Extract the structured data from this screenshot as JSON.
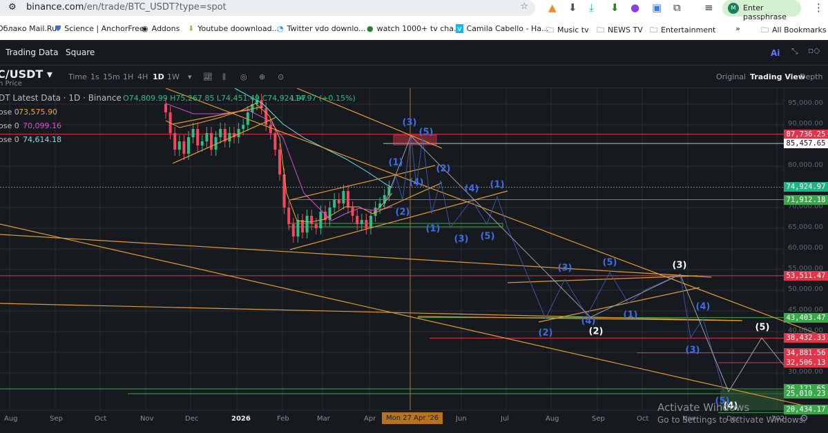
{
  "browser": {
    "url_host": "binance.com",
    "url_path": "/en/trade/BTC_USDT?type=spot",
    "profile_label": "Enter passphrase",
    "profile_initial": "M",
    "bookmarks": [
      "Облако Mail.Ru",
      "Science | AnchorFree",
      "Addons",
      "Youtube doownload...",
      "Twitter vdo downlo...",
      "watch 1000+ tv cha...",
      "Camila Cabello - Ha...",
      "Music tv",
      "NEWS TV",
      "Entertainment",
      "»",
      "All Bookmarks"
    ]
  },
  "nav": {
    "items": [
      "Trading Data",
      "Square"
    ],
    "ai_label": "Ai"
  },
  "toolbar": {
    "symbol": "C/USDT",
    "subtitle": "n Price",
    "intervals": [
      "Time",
      "1s",
      "15m",
      "1H",
      "4H",
      "1D",
      "1W"
    ],
    "active_interval": "1D",
    "views": [
      "Original",
      "Trading View",
      "Depth"
    ],
    "active_view": "Trading View"
  },
  "legend": {
    "title": "DT Latest Data · 1D · Binance",
    "ohlc": "O74,809.99 H75,267.85 L74,451.49 C74,924.97",
    "change": "114.97 (+0.15%)",
    "mas": [
      {
        "label": "ose 0",
        "value": "73,575.90",
        "color": "#f0a53a"
      },
      {
        "label": "ose 0",
        "value": "70,099.16",
        "color": "#d94fd4"
      },
      {
        "label": "ose 0",
        "value": "74,614.18",
        "color": "#6ee0e6"
      }
    ]
  },
  "chart_data": {
    "type": "candlestick",
    "price_ticks": [
      "95,000.00",
      "90,000.00",
      "80,000.00",
      "70,000.00",
      "65,000.00",
      "60,000.00",
      "55,000.00",
      "50,000.00",
      "45,000.00",
      "40,000.00",
      "35,000.00",
      "30,000.00"
    ],
    "time_ticks": [
      "Aug",
      "Sep",
      "Oct",
      "Nov",
      "Dec",
      "2026",
      "Feb",
      "Mar",
      "Apr",
      "Mon 27 Apr '26",
      "Jun",
      "Jul",
      "Aug",
      "Sep",
      "Oct",
      "Nov",
      "Dec",
      "202"
    ],
    "approx_closes": [
      93000,
      88000,
      84000,
      86000,
      83000,
      87000,
      89000,
      85000,
      86000,
      88000,
      84000,
      87000,
      89000,
      86000,
      88000,
      87000,
      89000,
      90000,
      93000,
      95000,
      96000,
      94000,
      90000,
      88000,
      84000,
      78000,
      70000,
      66000,
      63000,
      67000,
      64000,
      68000,
      66000,
      65000,
      69000,
      67000,
      70000,
      72000,
      71000,
      74000,
      70000,
      68000,
      66000,
      67000,
      65000,
      68000,
      70000,
      71000,
      73000,
      75000
    ],
    "price_labels": [
      {
        "value": "87,736.25",
        "color": "#e0354a"
      },
      {
        "value": "85,457.65",
        "color": "#ffffff"
      },
      {
        "value": "74,924.97",
        "color": "#1fb482"
      },
      {
        "value": "71,912.18",
        "color": "#3aa84a"
      },
      {
        "value": "53,511.47",
        "color": "#e0354a"
      },
      {
        "value": "43,403.47",
        "color": "#3aa84a"
      },
      {
        "value": "38,432.33",
        "color": "#e0354a"
      },
      {
        "value": "34,881.56",
        "color": "#e0354a"
      },
      {
        "value": "32,506.13",
        "color": "#e0354a"
      },
      {
        "value": "26,171.65",
        "color": "#3aa84a"
      },
      {
        "value": "25,010.23",
        "color": "#3aa84a"
      },
      {
        "value": "20,434.17",
        "color": "#3aa84a"
      }
    ],
    "wave_labels_blue": [
      "(3)",
      "(5)",
      "(1)",
      "(2)",
      "(4)",
      "(4)",
      "(1)",
      "(2)",
      "(1)",
      "(3)",
      "(5)",
      "(3)",
      "(5)",
      "(4)",
      "(1)",
      "(2)",
      "(4)",
      "(3)",
      "(5)"
    ],
    "wave_labels_white": [
      "(3)",
      "(2)",
      "(5)",
      "(4)"
    ]
  },
  "watermark": {
    "line1": "Activate Windows",
    "line2": "Go to Settings to activate Windows."
  }
}
